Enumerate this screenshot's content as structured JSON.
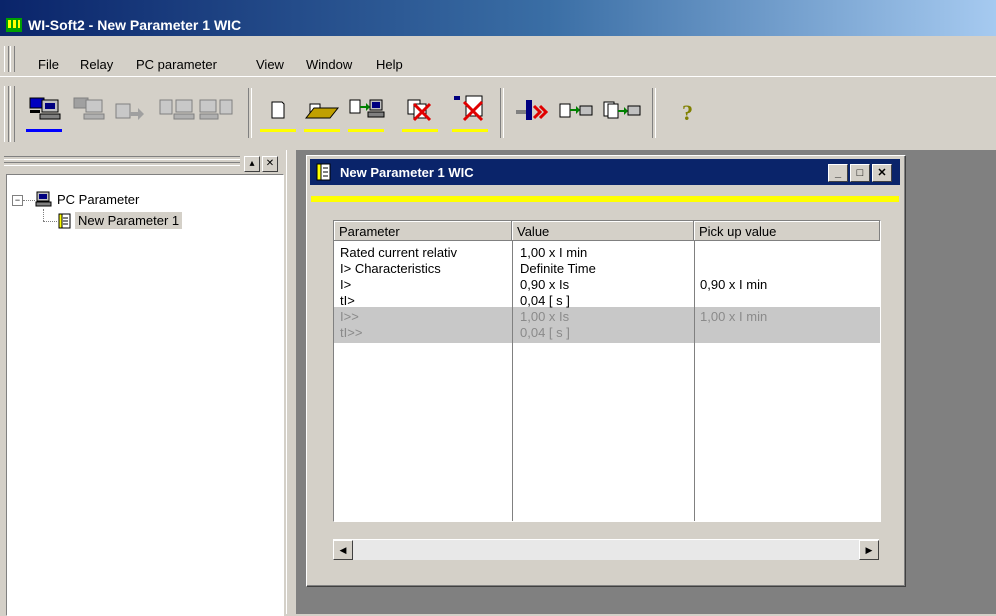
{
  "app": {
    "title": "WI-Soft2 - New Parameter 1  WIC"
  },
  "menu": [
    "File",
    "Relay",
    "PC parameter",
    "View",
    "Window",
    "Help"
  ],
  "tree": {
    "root": "PC Parameter",
    "child": "New Parameter 1"
  },
  "child_window": {
    "title": "New Parameter 1  WIC"
  },
  "table": {
    "headers": [
      "Parameter",
      "Value",
      "Pick up value"
    ],
    "rows": [
      {
        "param": "Rated current relativ",
        "value": "1,00 x I min",
        "pickup": ""
      },
      {
        "param": "I> Characteristics",
        "value": "Definite Time",
        "pickup": ""
      },
      {
        "param": "I>",
        "value": "0,90  x Is",
        "pickup": "0,90 x I min"
      },
      {
        "param": "tI>",
        "value": "0,04  [ s ]",
        "pickup": ""
      },
      {
        "param": "I>>",
        "value": "1,00  x Is",
        "pickup": "1,00 x I min"
      },
      {
        "param": "tI>>",
        "value": "0,04  [ s ]",
        "pickup": ""
      }
    ]
  },
  "icons": {
    "toolbar": [
      "relay-connect-icon",
      "relay-disconnect-icon",
      "relay-to-pc-icon",
      "pc-to-relay-icon",
      "relay-compare-icon",
      "new-file-icon",
      "open-folder-icon",
      "transfer-to-pc-icon",
      "delete-parameter-icon",
      "delete-relay-data-icon",
      "tools-icon",
      "print-preview-icon",
      "print-icon",
      "help-icon"
    ]
  },
  "colors": {
    "titlebar": "#0a246a",
    "highlight": "#ffff00",
    "disabled_row": "#c8c8c8"
  }
}
